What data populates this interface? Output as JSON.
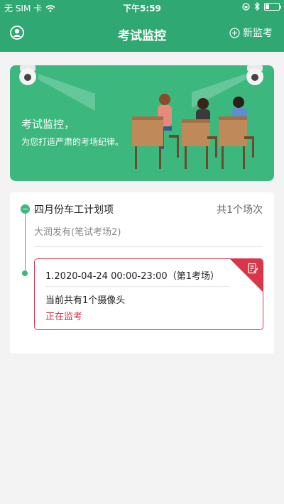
{
  "status_bar": {
    "carrier": "无 SIM 卡",
    "time": "下午5:59",
    "battery_level": 0.3
  },
  "nav": {
    "title": "考试监控",
    "new_button": "新监考",
    "icons": [
      "user-circle-icon",
      "plus-circle-icon"
    ]
  },
  "banner": {
    "title": "考试监控，",
    "subtitle": "为您打造严肃的考场纪律。"
  },
  "plan": {
    "title": "四月份车工计划项",
    "count": "共1个场次",
    "place": "大润发有(笔试考场2)",
    "sessions": [
      {
        "time": "1.2020-04-24 00:00-23:00（第1考场）",
        "cameras": "当前共有1个摄像头",
        "status": "正在监考",
        "accent": "#d9364a"
      }
    ]
  },
  "colors": {
    "brand": "#2fa873",
    "banner": "#3cb87e",
    "alert": "#d9364a"
  }
}
